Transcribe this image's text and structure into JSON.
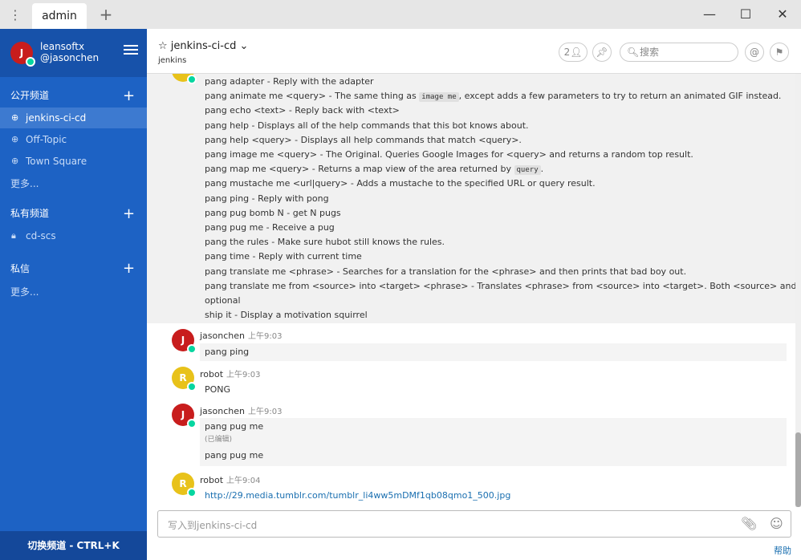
{
  "tabbar": {
    "tab_label": "admin"
  },
  "sidebar": {
    "user_name": "leansoftx",
    "user_handle": "@jasonchen",
    "user_initial": "J",
    "public_section": "公开频道",
    "public_channels": [
      "jenkins-ci-cd",
      "Off-Topic",
      "Town Square"
    ],
    "public_more": "更多...",
    "private_section": "私有频道",
    "private_channels": [
      "cd-scs"
    ],
    "dm_section": "私信",
    "dm_more": "更多...",
    "footer": "切换频道 - CTRL+K"
  },
  "channel": {
    "title": "jenkins-ci-cd",
    "purpose": "jenkins",
    "member_count": "2",
    "search_placeholder": "搜索"
  },
  "help_lines": [
    {
      "pre": "pang adapter - Reply with the adapter"
    },
    {
      "pre": "pang animate me <query> - The same thing as ",
      "code": "image me",
      "post": ", except adds a few parameters to try to return an animated GIF instead."
    },
    {
      "pre": "pang echo <text> - Reply back with <text>"
    },
    {
      "pre": "pang help - Displays all of the help commands that this bot knows about."
    },
    {
      "pre": "pang help <query> - Displays all help commands that match <query>."
    },
    {
      "pre": "pang image me <query> - The Original. Queries Google Images for <query> and returns a random top result."
    },
    {
      "pre": "pang map me <query> - Returns a map view of the area returned by ",
      "code": "query",
      "post": "."
    },
    {
      "pre": "pang mustache me <url|query> - Adds a mustache to the specified URL or query result."
    },
    {
      "pre": "pang ping - Reply with pong"
    },
    {
      "pre": "pang pug bomb N - get N pugs"
    },
    {
      "pre": "pang pug me - Receive a pug"
    },
    {
      "pre": "pang the rules - Make sure hubot still knows the rules."
    },
    {
      "pre": "pang time - Reply with current time"
    },
    {
      "pre": "pang translate me <phrase> - Searches for a translation for the <phrase> and then prints that bad boy out."
    },
    {
      "pre": "pang translate me from <source> into <target> <phrase> - Translates <phrase> from <source> into <target>. Both <source> and <target> are"
    },
    {
      "pre": "optional"
    },
    {
      "pre": "ship it - Display a motivation squirrel"
    }
  ],
  "messages": {
    "m1": {
      "author": "jasonchen",
      "initial": "J",
      "time": "上午9:03",
      "text": "pang ping"
    },
    "m2": {
      "author": "robot",
      "initial": "R",
      "time": "上午9:03",
      "text": "PONG"
    },
    "m3": {
      "author": "jasonchen",
      "initial": "J",
      "time": "上午9:03",
      "text": "pang pug me",
      "edited": "(已编辑)",
      "text2": "pang pug me"
    },
    "m4": {
      "author": "robot",
      "initial": "R",
      "time": "上午9:04",
      "link": "http://29.media.tumblr.com/tumblr_li4ww5mDMf1qb08qmo1_500.jpg"
    }
  },
  "composer": {
    "placeholder": "写入到jenkins-ci-cd",
    "help": "帮助"
  },
  "colors": {
    "sidebar": "#1d62c4",
    "avatar_j": "#c81d1d",
    "avatar_r": "#e8c21a",
    "online": "#06d6a0"
  }
}
